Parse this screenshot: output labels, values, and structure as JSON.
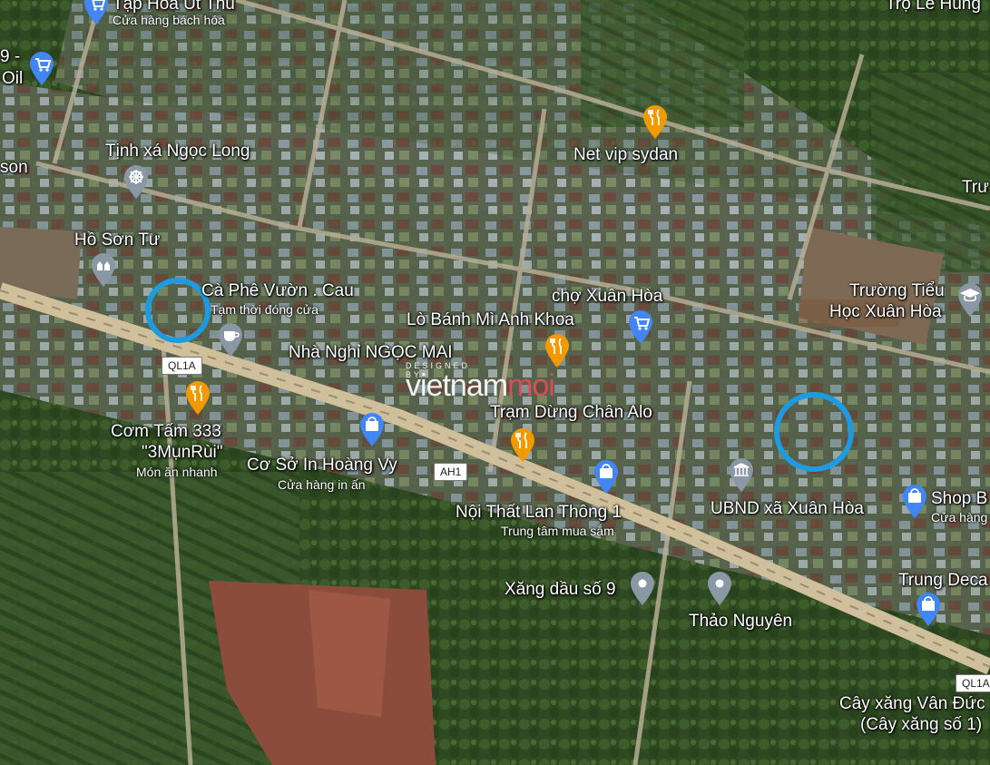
{
  "map": {
    "places": [
      {
        "name": "Tạp Hóa Út Thu",
        "category": "Cửa hàng bách hóa",
        "icon": "shopping-cart-icon",
        "color": "#4285f4"
      },
      {
        "name": "Tịnh xá Ngọc Long",
        "icon": "dharma-wheel-icon",
        "color": "#8a97a4"
      },
      {
        "name": "Hồ Sơn Tư",
        "icon": "temple-icon",
        "color": "#8a97a4"
      },
      {
        "name": "Cà Phê Vườn . Cau",
        "category": "Tạm thời đóng cửa",
        "icon": "coffee-cup-icon",
        "color": "#8a97a4"
      },
      {
        "name": "Nhà Nghỉ NGỌC MAI"
      },
      {
        "name": "Cơm Tấm 333",
        "extra": "\"3MụnRùi\"",
        "category": "Món ăn nhanh",
        "icon": "fork-knife-icon",
        "color": "#f29900"
      },
      {
        "name": "Cơ Sở In Hoàng Vy",
        "category": "Cửa hàng in ấn",
        "icon": "shopping-bag-icon",
        "color": "#4285f4"
      },
      {
        "name": "Net vip sydan",
        "icon": "fork-knife-icon",
        "color": "#f29900"
      },
      {
        "name": "chợ Xuân Hòa",
        "icon": "shopping-cart-icon",
        "color": "#4285f4"
      },
      {
        "name": "Lò Bánh Mì Anh Khoa",
        "icon": "fork-knife-icon",
        "color": "#f29900"
      },
      {
        "name": "Trạm Dừng Chân Alo",
        "icon": "fork-knife-icon",
        "color": "#f29900"
      },
      {
        "name": "Nội Thất Lan Thông 1",
        "category": "Trung tâm mua sắm",
        "icon": "shopping-bag-icon",
        "color": "#4285f4"
      },
      {
        "name": "Xăng dầu số 9",
        "icon": "location-pin-icon",
        "color": "#8a97a4"
      },
      {
        "name": "Thảo Nguyên",
        "icon": "location-pin-icon",
        "color": "#8a97a4"
      },
      {
        "name": "UBND xã Xuân Hòa",
        "icon": "government-building-icon",
        "color": "#8a97a4"
      },
      {
        "name": "Trường Tiểu",
        "name2": "Học Xuân Hòa",
        "icon": "graduation-cap-icon",
        "color": "#8a97a4"
      },
      {
        "name": "Shop B",
        "category": "Cửa hàng",
        "icon": "shopping-bag-icon",
        "color": "#4285f4"
      },
      {
        "name": "Trung Deca",
        "icon": "shopping-bag-icon",
        "color": "#4285f4"
      },
      {
        "name": "Cây xăng Vân Đức",
        "name2": "(Cây xăng số 1)"
      },
      {
        "name": "Trọ Lê Hùng"
      },
      {
        "name": "9 -",
        "name2": "Oil",
        "icon": "shopping-cart-icon",
        "color": "#4285f4"
      },
      {
        "name": "son"
      },
      {
        "name": "Trư"
      }
    ],
    "road_shields": [
      "QL1A",
      "AH1",
      "QL1A"
    ],
    "watermark": {
      "designed_by": "DESIGNED BY",
      "brand_main": "vietnam",
      "brand_accent": "moi"
    },
    "highlight_color": "#1e9be0"
  }
}
